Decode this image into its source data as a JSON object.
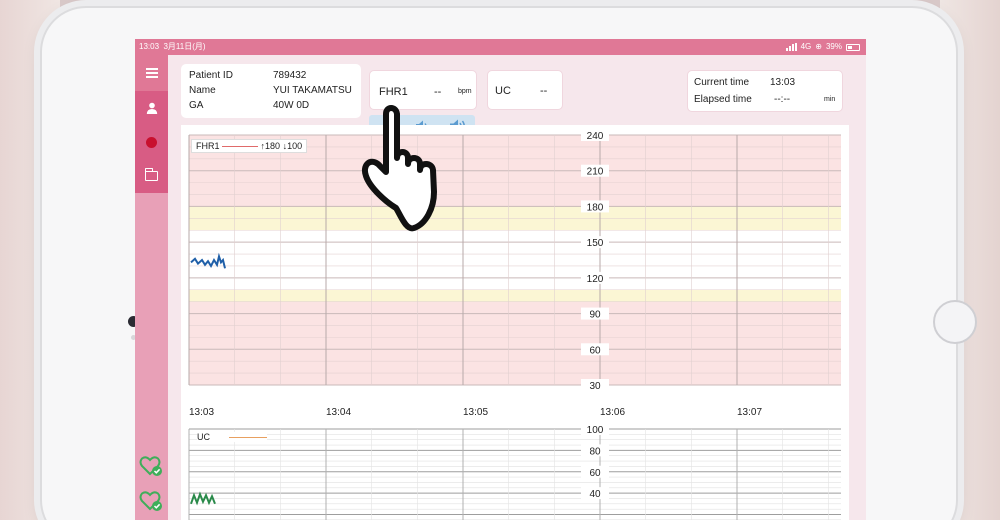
{
  "status_bar": {
    "time": "13:03",
    "date": "3月11日(月)",
    "network": "4G",
    "battery": "39%"
  },
  "patient": {
    "id_label": "Patient ID",
    "id_value": "789432",
    "name_label": "Name",
    "name_value": "YUI TAKAMATSU",
    "ga_label": "GA",
    "ga_value": "40W 0D"
  },
  "fhr1": {
    "label": "FHR1",
    "value": "--",
    "unit": "bpm"
  },
  "uc": {
    "label": "UC",
    "value": "--"
  },
  "clock": {
    "current_label": "Current time",
    "current_value": "13:03",
    "elapsed_label": "Elapsed time",
    "elapsed_value": "--:--",
    "elapsed_unit": "min"
  },
  "fhr_chart": {
    "legend_name": "FHR1",
    "legend_range": "↑180 ↓100",
    "y_ticks": [
      "240",
      "210",
      "180",
      "150",
      "120",
      "90",
      "60",
      "30"
    ],
    "ylim": [
      30,
      240
    ],
    "colors": {
      "normal_band": "#ffffff",
      "warning_band": "#fbf6d4",
      "alert_band": "#fbe3e3",
      "trace": "#1f5fa8"
    }
  },
  "time_axis": [
    "13:03",
    "13:04",
    "13:05",
    "13:06",
    "13:07"
  ],
  "uc_chart": {
    "legend_name": "UC",
    "y_ticks": [
      "100",
      "80",
      "60",
      "40"
    ],
    "colors": {
      "legend_line": "#e8a060",
      "trace": "#2a8a4a"
    }
  },
  "icons": {
    "menu": "menu-icon",
    "patient": "person-icon",
    "record": "record-icon",
    "files": "folder-icon",
    "sound_mute": "speaker-low-icon",
    "sound_on": "speaker-high-icon",
    "cursor": "hand-pointer-icon",
    "status": "heart-check-icon"
  }
}
